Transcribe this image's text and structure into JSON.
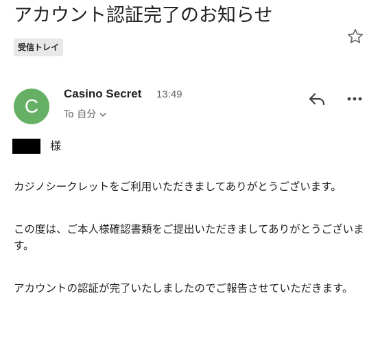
{
  "email": {
    "subject": "アカウント認証完了のお知らせ",
    "label": "受信トレイ",
    "sender": {
      "initial": "C",
      "name": "Casino Secret",
      "time": "13:49",
      "recipient": "To 自分",
      "avatar_color": "#66b066"
    },
    "salutation": "様",
    "paragraphs": [
      "カジノシークレットをご利用いただきましてありがとうございます。",
      "この度は、ご本人様確認書類をご提出いただきましてありがとうございます。",
      "アカウントの認証が完了いたしましたのでご報告させていただきます。"
    ]
  },
  "icons": {
    "star": "star-icon",
    "reply": "reply-icon",
    "more": "more-options-icon",
    "chevron": "chevron-down-icon"
  }
}
